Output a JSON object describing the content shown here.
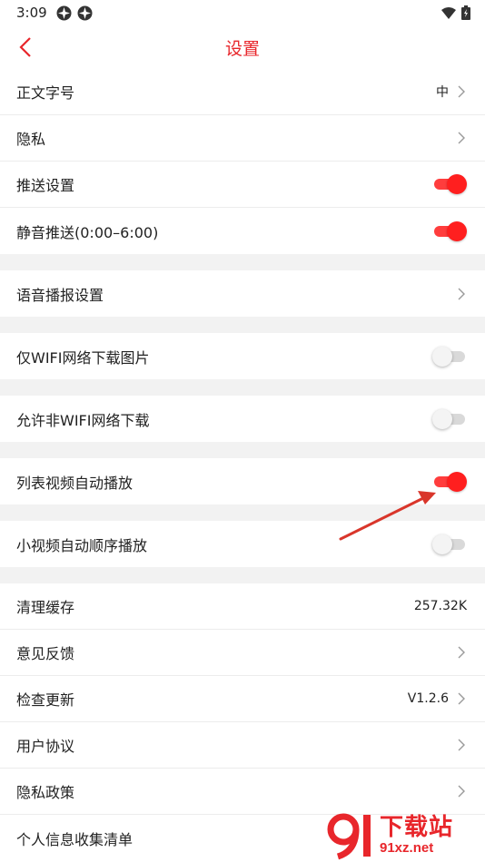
{
  "status_bar": {
    "time": "3:09"
  },
  "header": {
    "title": "设置"
  },
  "groups": [
    [
      {
        "label": "正文字号",
        "value": "中",
        "chevron": true
      },
      {
        "label": "隐私",
        "chevron": true
      },
      {
        "label": "推送设置",
        "toggle": "on"
      },
      {
        "label": "静音推送(0:00–6:00)",
        "toggle": "on"
      }
    ],
    [
      {
        "label": "语音播报设置",
        "chevron": true
      }
    ],
    [
      {
        "label": "仅WIFI网络下载图片",
        "toggle": "off"
      }
    ],
    [
      {
        "label": "允许非WIFI网络下载",
        "toggle": "off"
      }
    ],
    [
      {
        "label": "列表视频自动播放",
        "toggle": "on"
      }
    ],
    [
      {
        "label": "小视频自动顺序播放",
        "toggle": "off"
      }
    ],
    [
      {
        "label": "清理缓存",
        "value": "257.32K"
      },
      {
        "label": "意见反馈",
        "chevron": true
      },
      {
        "label": "检查更新",
        "value": "V1.2.6",
        "chevron": true
      },
      {
        "label": "用户协议",
        "chevron": true
      },
      {
        "label": "隐私政策",
        "chevron": true
      },
      {
        "label": "个人信息收集清单",
        "chevron": false
      }
    ]
  ],
  "watermark": {
    "line1": "下载站",
    "line2": "91xz.net"
  },
  "colors": {
    "accent": "#e8262b",
    "toggle_on": "#ff1f1f",
    "toggle_off": "#d9d9d9",
    "divider": "#ececec",
    "section_bg": "#f2f2f2"
  }
}
